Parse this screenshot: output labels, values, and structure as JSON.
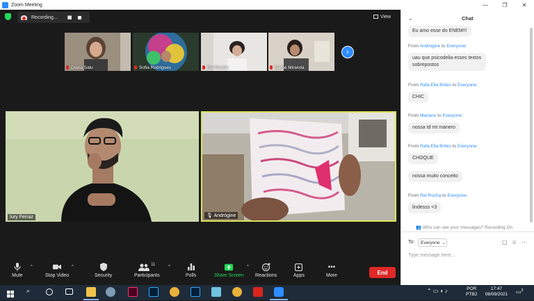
{
  "window": {
    "title": "Zoom Meeting"
  },
  "recording": {
    "label": "Recording...",
    "pause_glyph": "▮▮"
  },
  "view": {
    "label": "View"
  },
  "thumbnails": [
    {
      "name": "Diana Salu"
    },
    {
      "name": "Sofia Rodrigues"
    },
    {
      "name": "Rel Rocha"
    },
    {
      "name": "Nathé Miranda"
    }
  ],
  "videos": [
    {
      "name": "Iury Ferraz"
    },
    {
      "name": "Andrógine"
    }
  ],
  "toolbar": {
    "mute": "Mute",
    "stop_video": "Stop Video",
    "security": "Security",
    "participants": "Participants",
    "participants_count": "11",
    "polls": "Polls",
    "share_screen": "Share Screen",
    "reactions": "Reactions",
    "apps": "Apps",
    "more": "More",
    "end": "End"
  },
  "chat": {
    "title": "Chat",
    "messages": [
      {
        "text": "Eu amo esse do ENEM!!!"
      },
      {
        "from": "Andrógine",
        "to": "Everyone",
        "text": "uau que psicodelia esses textos sobrepostos"
      },
      {
        "from": "Rafa Ella Brites",
        "to": "Everyone",
        "text": "CHIC"
      },
      {
        "from": "Mariano",
        "to": "Everyone",
        "text": "nossa td mt manero"
      },
      {
        "from": "Rafa Ella Brites",
        "to": "Everyone",
        "text": "CHOQUE"
      },
      {
        "text": "nossa muito conceito"
      },
      {
        "from": "Rel Rocha",
        "to": "Everyone",
        "text": "lindesss <3"
      }
    ],
    "from_word": "From",
    "to_word": "to",
    "who_can_see": "Who can see your messages? Recording On",
    "to_label": "To:",
    "to_value": "Everyone",
    "placeholder": "Type message here..."
  },
  "taskbar": {
    "language": "POR",
    "layout": "PTB2",
    "time": "17:47",
    "date": "08/09/2021",
    "notifications": "3"
  },
  "colors": {
    "accent": "#2d8cff",
    "end": "#e02828",
    "share": "#23d959",
    "active_speaker": "#d9e35b"
  }
}
